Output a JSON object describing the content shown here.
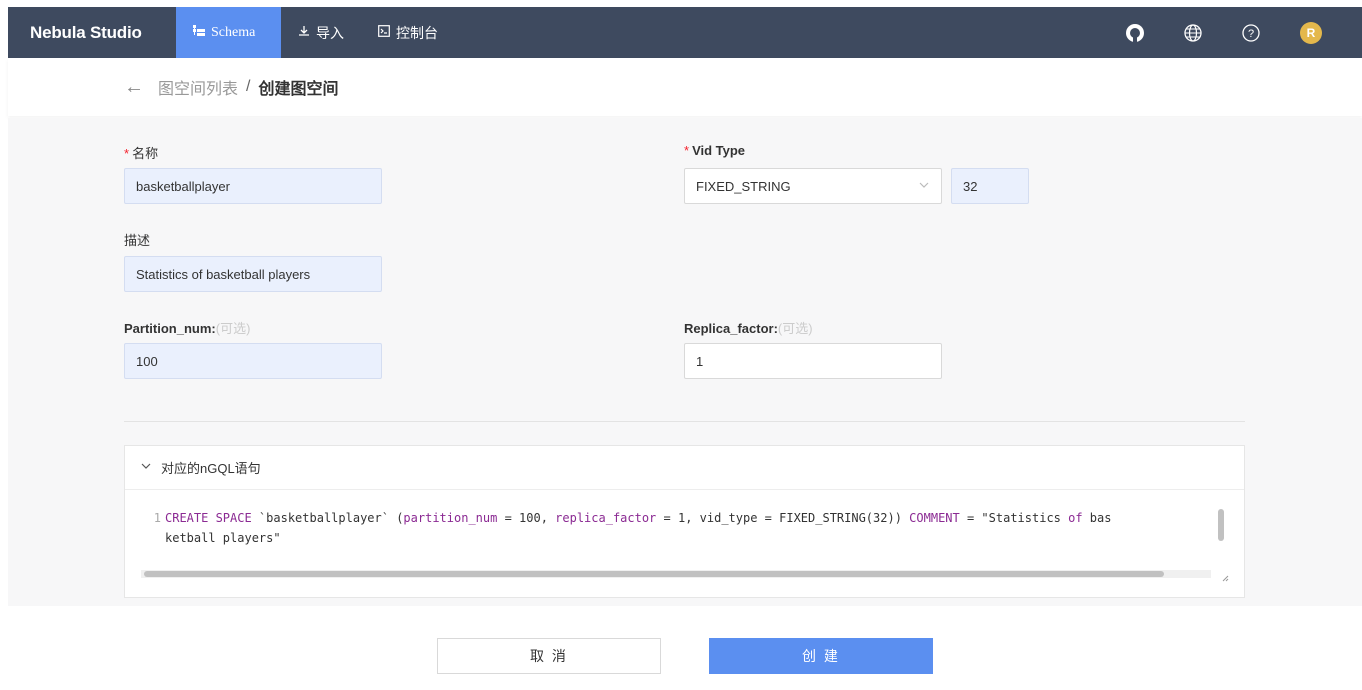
{
  "header": {
    "logo": "Nebula Studio",
    "tabs": [
      {
        "label": "Schema",
        "icon": "schema-icon",
        "active": true
      },
      {
        "label": "导入",
        "icon": "import-icon",
        "active": false
      },
      {
        "label": "控制台",
        "icon": "console-icon",
        "active": false
      }
    ],
    "right_icons": [
      "github-icon",
      "globe-icon",
      "help-icon"
    ],
    "avatar_initial": "R",
    "colors": {
      "bar": "#3e4a5f",
      "active_tab": "#5b8ff0",
      "avatar": "#e4b84c"
    }
  },
  "breadcrumb": {
    "parent": "图空间列表",
    "separator": "/",
    "current": "创建图空间"
  },
  "form": {
    "name": {
      "label": "名称",
      "required_mark": "*",
      "value": "basketballplayer"
    },
    "vid_type": {
      "label": "Vid Type",
      "required_mark": "*",
      "value": "FIXED_STRING",
      "length": "32"
    },
    "description": {
      "label": "描述",
      "value": "Statistics of basketball players"
    },
    "partition_num": {
      "label": "Partition_num:",
      "optional": "(可选)",
      "value": "100"
    },
    "replica_factor": {
      "label": "Replica_factor:",
      "optional": "(可选)",
      "value": "1"
    }
  },
  "ngql": {
    "title": "对应的nGQL语句",
    "line_number": "1",
    "line1": {
      "kw1": "CREATE SPACE",
      "t1": " `basketballplayer` (",
      "kw2": "partition_num",
      "t2": " = 100, ",
      "kw3": "replica_factor",
      "t3": " = 1, vid_type = FIXED_STRING(32)) ",
      "kw4": "COMMENT",
      "t4": " = \"Statistics ",
      "kw5": "of",
      "t5": " bas"
    },
    "line2": "ketball players\""
  },
  "actions": {
    "cancel": "取 消",
    "create": "创 建"
  }
}
